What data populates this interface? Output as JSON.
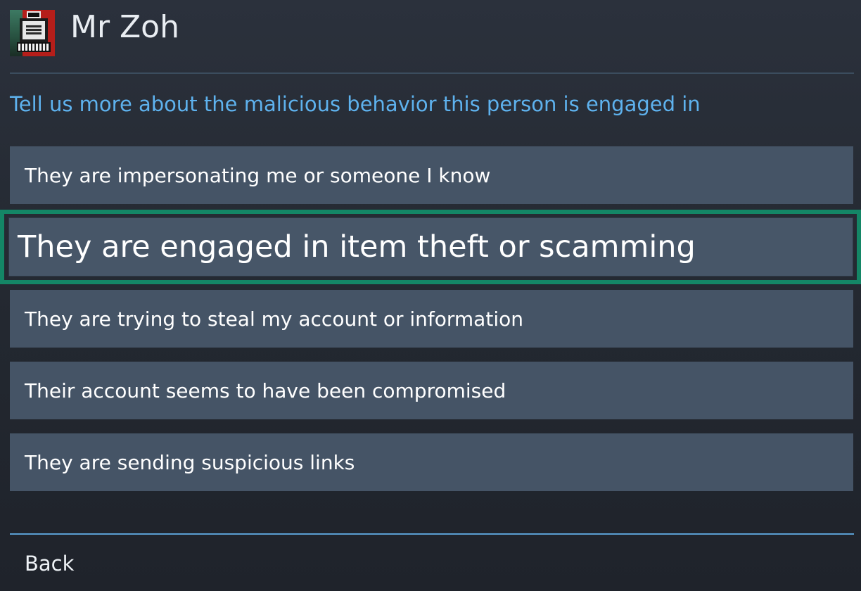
{
  "profile": {
    "name": "Mr Zoh",
    "avatar_icon": "retro-computer-avatar-icon"
  },
  "report": {
    "prompt": "Tell us more about the malicious behavior this person is engaged in",
    "options": [
      {
        "label": "They are impersonating me or someone I know",
        "selected": false
      },
      {
        "label": "They are engaged in item theft or scamming",
        "selected": true
      },
      {
        "label": "They are trying to steal my account or information",
        "selected": false
      },
      {
        "label": "Their account seems to have been compromised",
        "selected": false
      },
      {
        "label": "They are sending suspicious links",
        "selected": false
      }
    ]
  },
  "footer": {
    "back_label": "Back"
  },
  "colors": {
    "prompt_text": "#5eb2ee",
    "option_background": "#455466",
    "selection_outline": "#148666",
    "bottom_divider": "#5a9fd2"
  }
}
